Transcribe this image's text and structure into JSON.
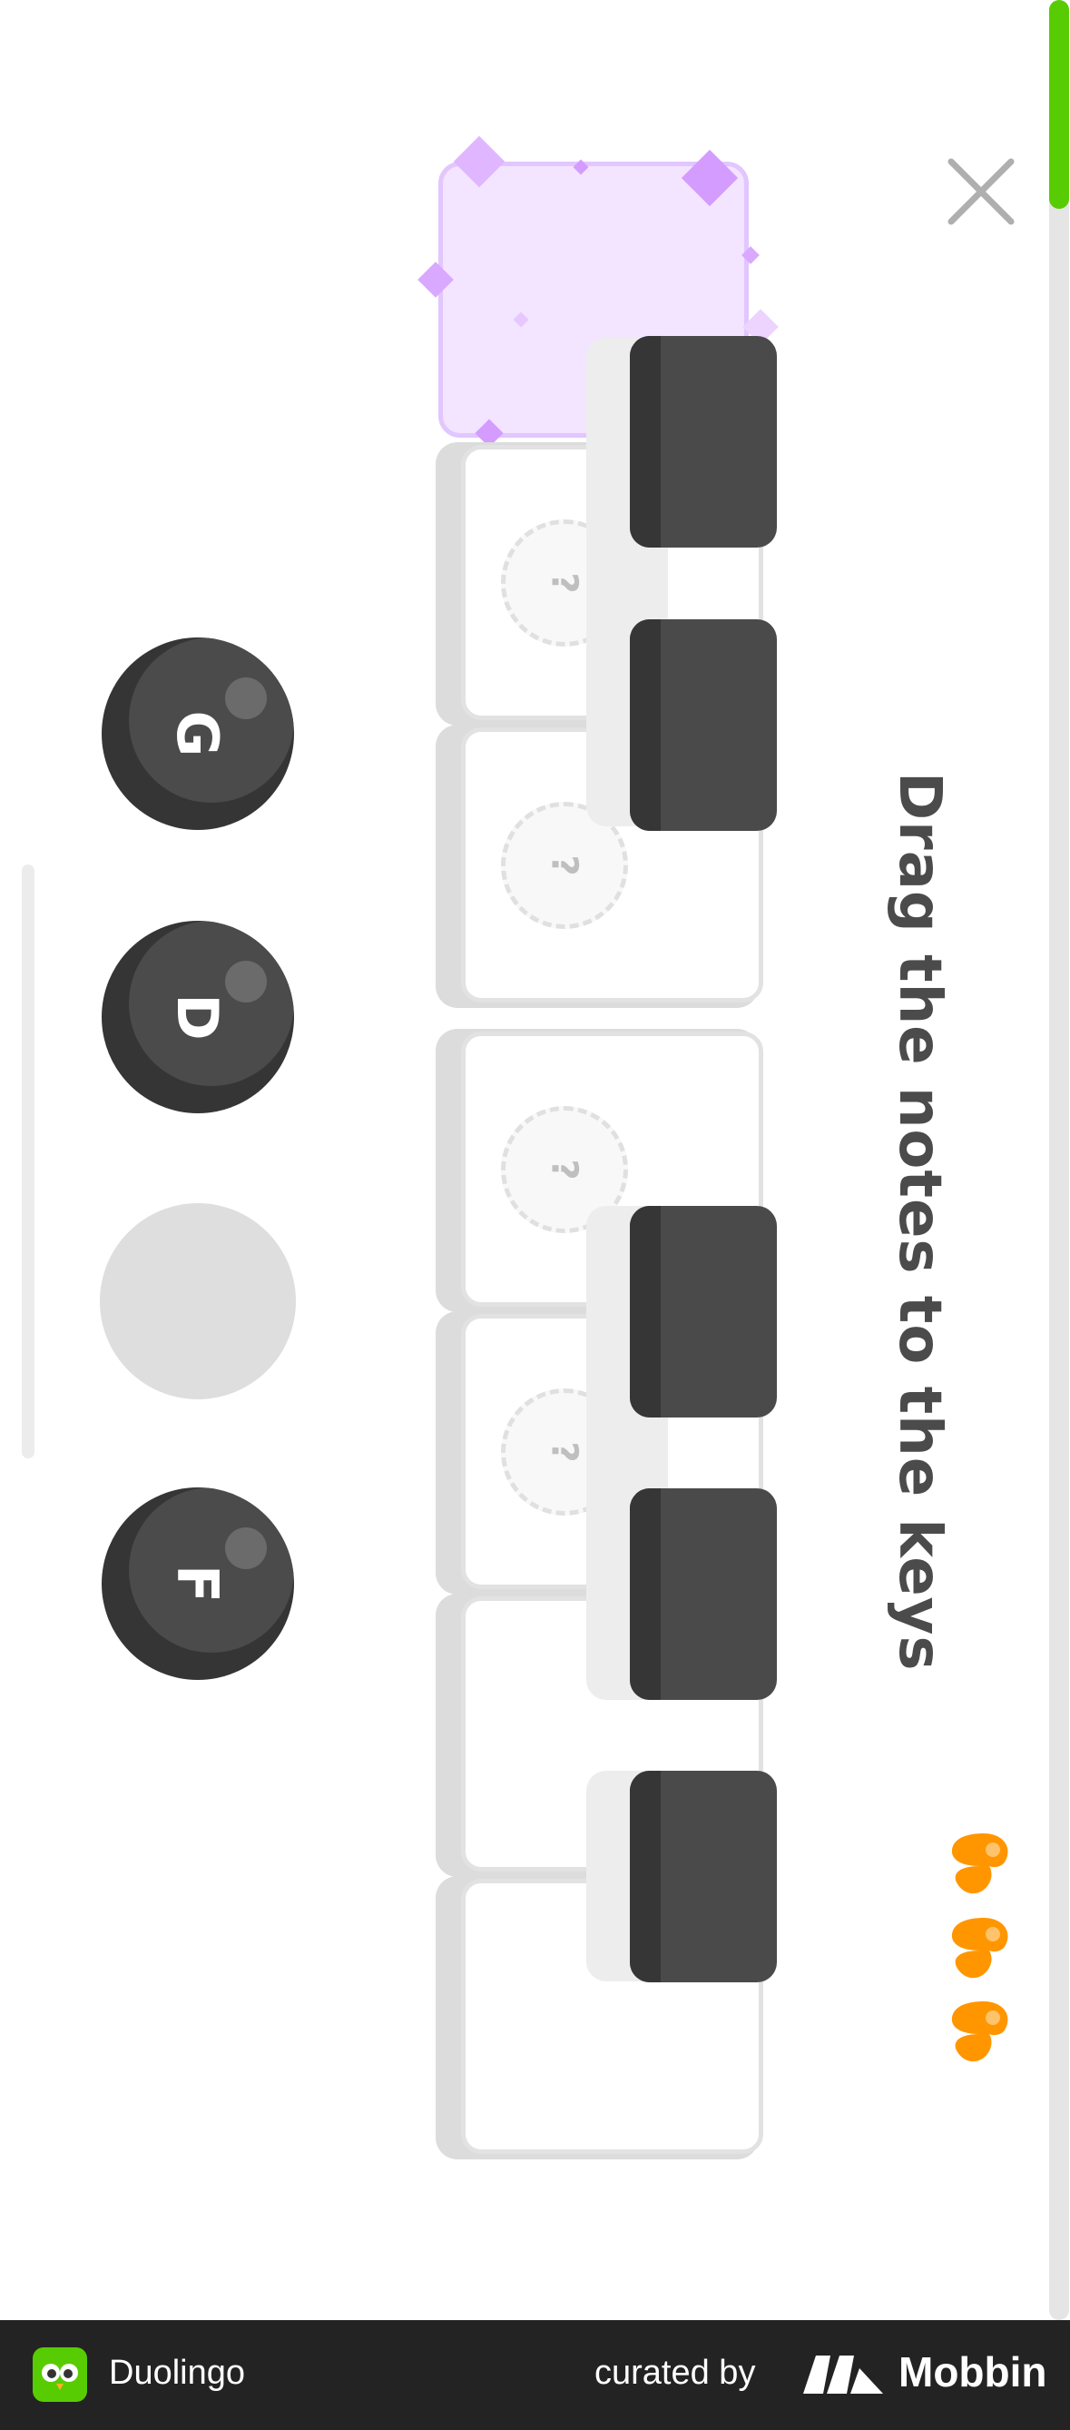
{
  "header": {
    "close_icon": "close-icon",
    "progress_fraction": 0.09
  },
  "prompt": {
    "text": "Drag the notes to the keys"
  },
  "hearts": {
    "count": 3,
    "icon": "heart-icon",
    "color": "#ff9600"
  },
  "piano": {
    "slots": [
      "?",
      "?",
      "?",
      "?"
    ]
  },
  "notes": {
    "tokens": [
      "G",
      "D",
      "",
      "F"
    ]
  },
  "footer": {
    "app_name": "Duolingo",
    "curated_by": "curated by",
    "brand": "Mobbin"
  },
  "colors": {
    "progress": "#58cc02",
    "highlight": "#f3e4ff",
    "black_key": "#4a4a4a",
    "note": "#4b4b4b"
  }
}
